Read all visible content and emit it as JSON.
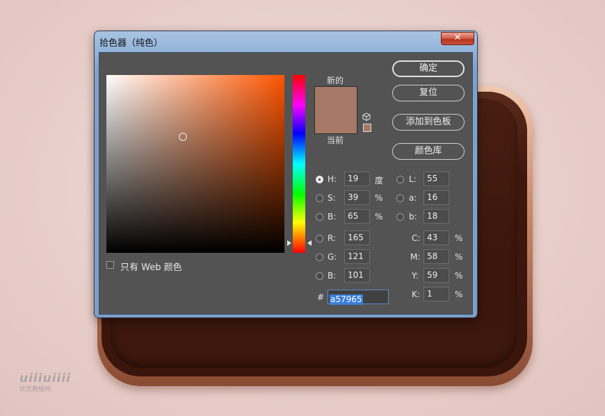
{
  "dialog": {
    "title": "拾色器（纯色）",
    "close_label": "✕"
  },
  "swatches": {
    "new_label": "新的",
    "current_label": "当前",
    "new_color": "#a57965",
    "current_color": "#a57965"
  },
  "buttons": {
    "ok": "确定",
    "reset": "复位",
    "add_to_swatches": "添加到色板",
    "color_libraries": "颜色库"
  },
  "hsb": {
    "h_label": "H:",
    "h_value": "19",
    "h_unit": "度",
    "s_label": "S:",
    "s_value": "39",
    "s_unit": "%",
    "b_label": "B:",
    "b_value": "65",
    "b_unit": "%",
    "selected": "H"
  },
  "rgb": {
    "r_label": "R:",
    "r_value": "165",
    "g_label": "G:",
    "g_value": "121",
    "b_label": "B:",
    "b_value": "101"
  },
  "lab": {
    "l_label": "L:",
    "l_value": "55",
    "a_label": "a:",
    "a_value": "16",
    "b_label": "b:",
    "b_value": "18"
  },
  "cmyk": {
    "c_label": "C:",
    "c_value": "43",
    "m_label": "M:",
    "m_value": "58",
    "y_label": "Y:",
    "y_value": "59",
    "k_label": "K:",
    "k_value": "1",
    "unit": "%"
  },
  "hex": {
    "label": "#",
    "value": "a57965"
  },
  "web_only": {
    "label": "只有 Web 颜色",
    "checked": false
  },
  "watermark": {
    "logo": "uiiiuiiii",
    "text": "优优教程网"
  }
}
